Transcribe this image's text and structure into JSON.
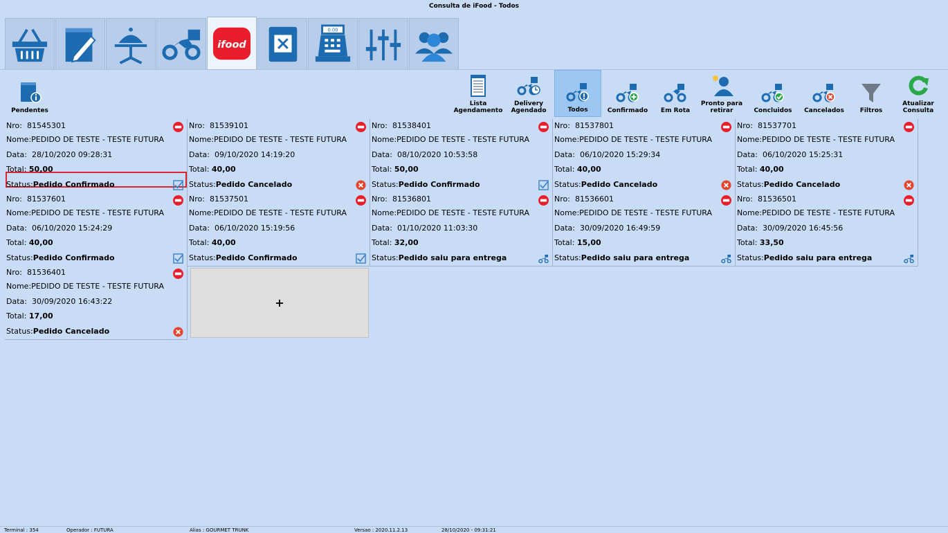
{
  "window": {
    "title": "Consulta de iFood - Todos"
  },
  "tabs": [
    {
      "name": "tab-vendas",
      "icon": "basket-icon"
    },
    {
      "name": "tab-pedidos",
      "icon": "notepad-pencil-icon"
    },
    {
      "name": "tab-mesas",
      "icon": "food-cloche-table-icon"
    },
    {
      "name": "tab-delivery",
      "icon": "motorcycle-delivery-icon"
    },
    {
      "name": "tab-ifood",
      "icon": "ifood-logo-icon",
      "label": "ifood"
    },
    {
      "name": "tab-cardapio",
      "icon": "menu-book-icon"
    },
    {
      "name": "tab-caixa",
      "icon": "cash-register-icon",
      "label": "0.00"
    },
    {
      "name": "tab-configuracoes",
      "icon": "sliders-icon"
    },
    {
      "name": "tab-clientes",
      "icon": "users-icon"
    }
  ],
  "toolbar": {
    "pendentes": "Pendentes",
    "lista_agendamento": "Lista Agendamento",
    "delivery_agendado": "Delivery Agendado",
    "todos": "Todos",
    "confirmado": "Confirmado",
    "em_rota": "Em Rota",
    "pronto_para_retirar": "Pronto para retirar",
    "concluidos": "Concluidos",
    "cancelados": "Cancelados",
    "filtros": "Filtros",
    "atualizar_consulta": "Atualizar Consulta"
  },
  "labels": {
    "nro": "Nro:",
    "nome": "Nome:",
    "data": "Data:",
    "total": "Total:",
    "status": "Status:",
    "add": "+"
  },
  "orders": [
    {
      "nro": "81545301",
      "nome": "PEDIDO DE TESTE - TESTE FUTURA",
      "data": "28/10/2020 09:28:31",
      "total": "50,00",
      "status": "Pedido Confirmado",
      "status_icon": "check-icon",
      "selected": true
    },
    {
      "nro": "81539101",
      "nome": "PEDIDO DE TESTE - TESTE FUTURA",
      "data": "09/10/2020 14:19:20",
      "total": "40,00",
      "status": "Pedido Cancelado",
      "status_icon": "cancel-icon"
    },
    {
      "nro": "81538401",
      "nome": "PEDIDO DE TESTE - TESTE FUTURA",
      "data": "08/10/2020 10:53:58",
      "total": "50,00",
      "status": "Pedido Confirmado",
      "status_icon": "check-icon"
    },
    {
      "nro": "81537801",
      "nome": "PEDIDO DE TESTE - TESTE FUTURA",
      "data": "06/10/2020 15:29:34",
      "total": "40,00",
      "status": "Pedido Cancelado",
      "status_icon": "cancel-icon"
    },
    {
      "nro": "81537701",
      "nome": "PEDIDO DE TESTE - TESTE FUTURA",
      "data": "06/10/2020 15:25:31",
      "total": "40,00",
      "status": "Pedido Cancelado",
      "status_icon": "cancel-icon"
    },
    {
      "nro": "81537601",
      "nome": "PEDIDO DE TESTE - TESTE FUTURA",
      "data": "06/10/2020 15:24:29",
      "total": "40,00",
      "status": "Pedido Confirmado",
      "status_icon": "check-icon"
    },
    {
      "nro": "81537501",
      "nome": "PEDIDO DE TESTE - TESTE FUTURA",
      "data": "06/10/2020 15:19:56",
      "total": "40,00",
      "status": "Pedido Confirmado",
      "status_icon": "check-icon"
    },
    {
      "nro": "81536801",
      "nome": "PEDIDO DE TESTE - TESTE FUTURA",
      "data": "01/10/2020 11:03:30",
      "total": "32,00",
      "status": "Pedido saiu para entrega",
      "status_icon": "motorcycle-icon"
    },
    {
      "nro": "81536601",
      "nome": "PEDIDO DE TESTE - TESTE FUTURA",
      "data": "30/09/2020 16:49:59",
      "total": "15,00",
      "status": "Pedido saiu para entrega",
      "status_icon": "motorcycle-icon"
    },
    {
      "nro": "81536501",
      "nome": "PEDIDO DE TESTE - TESTE FUTURA",
      "data": "30/09/2020 16:45:56",
      "total": "33,50",
      "status": "Pedido saiu para entrega",
      "status_icon": "motorcycle-icon"
    },
    {
      "nro": "81536401",
      "nome": "PEDIDO DE TESTE - TESTE FUTURA",
      "data": "30/09/2020 16:43:22",
      "total": "17,00",
      "status": "Pedido Cancelado",
      "status_icon": "cancel-icon"
    }
  ],
  "statusbar": {
    "terminal": "Terminal : 354",
    "operador": "Operador : FUTURA",
    "alias": "Alias : GOURMET TRUNK",
    "versao": "Versao : 2020.11.2.13",
    "datetime": "28/10/2020 - 09:31:21"
  },
  "colors": {
    "background": "#c9dcf6",
    "ifood_red": "#ea1d2c",
    "cancel_red": "#e8432c",
    "check_blue": "#3a82c8",
    "blue_icon": "#2d72b8",
    "refresh_green": "#2aa84a",
    "active_toolbar": "#9cc7f3",
    "selection_border": "#d9232e"
  }
}
